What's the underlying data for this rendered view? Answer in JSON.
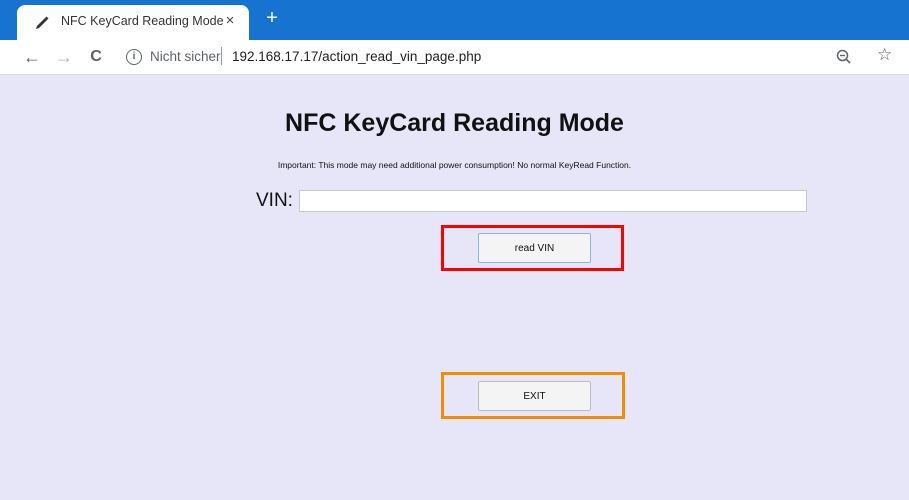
{
  "browser": {
    "tab_title": "NFC KeyCard Reading Mode",
    "tab_close": "×",
    "new_tab": "+",
    "nav": {
      "back": "←",
      "forward": "→",
      "reload": "C"
    },
    "security_text": "Nicht sicher",
    "url": "192.168.17.17/action_read_vin_page.php",
    "info_glyph": "i",
    "star_glyph": "☆",
    "icons": [
      "pen-icon",
      "close-icon",
      "plus-icon",
      "back-arrow-icon",
      "forward-arrow-icon",
      "reload-icon",
      "info-icon",
      "zoom-out-icon",
      "star-icon"
    ]
  },
  "page": {
    "title": "NFC KeyCard Reading Mode",
    "subtitle": "Important: This mode may need additional power consumption! No normal KeyRead Function.",
    "vin_label": "VIN:",
    "vin_value": "",
    "read_button": "read VIN",
    "exit_button": "EXIT",
    "highlight_colors": {
      "read": "#ff0000",
      "exit": "#f28c00"
    },
    "background": "#e6e6f8"
  }
}
